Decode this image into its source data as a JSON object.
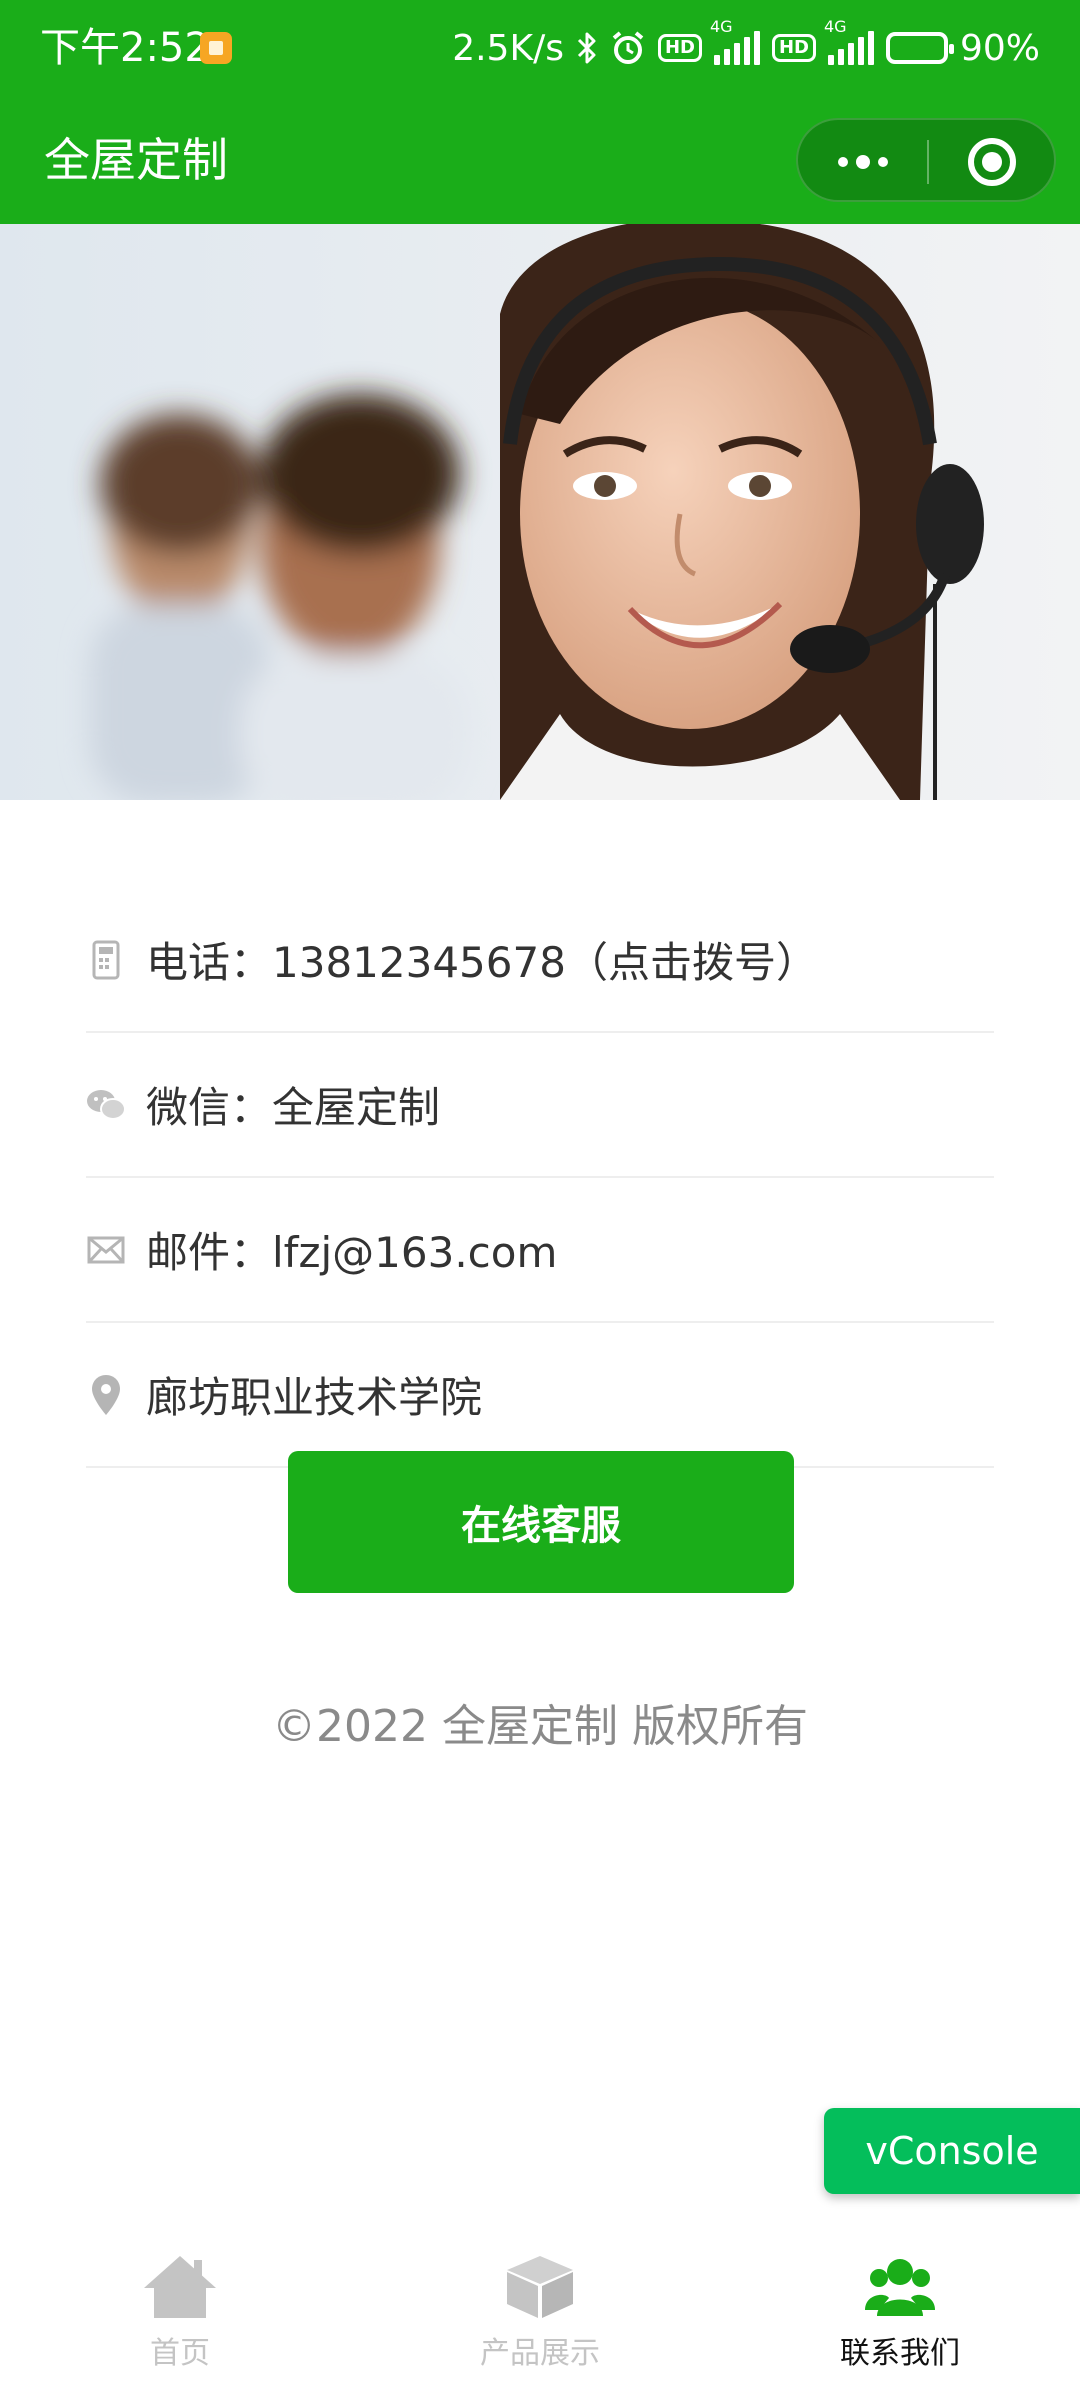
{
  "status_bar": {
    "time": "下午2:52",
    "network_speed": "2.5K/s",
    "hd1": "HD",
    "sig1_tag": "4G",
    "hd2": "HD",
    "sig2_tag": "4G",
    "battery": "90%"
  },
  "nav": {
    "title": "全屋定制"
  },
  "contact": {
    "phone": "电话：13812345678（点击拨号）",
    "wechat": "微信：全屋定制",
    "email": "邮件：lfzj@163.com",
    "address": "廊坊职业技术学院"
  },
  "service_button": "在线客服",
  "copyright": "©2022 全屋定制 版权所有",
  "vconsole": "vConsole",
  "tabs": [
    {
      "label": "首页",
      "icon": "home-icon"
    },
    {
      "label": "产品展示",
      "icon": "box-icon"
    },
    {
      "label": "联系我们",
      "icon": "users-icon"
    }
  ],
  "colors": {
    "brand_green": "#1aad19",
    "vconsole_green": "#04be5b",
    "inactive_tab": "#c4c4c4"
  }
}
